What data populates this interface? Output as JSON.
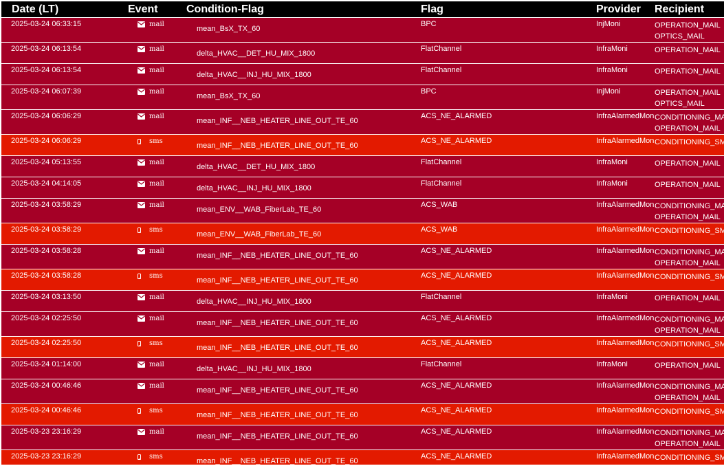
{
  "columns": {
    "date": "Date (LT)",
    "event": "Event",
    "condition": "Condition-Flag",
    "flag": "Flag",
    "provider": "Provider",
    "recipient": "Recipient"
  },
  "colors": {
    "header_bg": "#000000",
    "mail_row_bg": "#a50026",
    "sms_row_bg": "#e31a00",
    "text": "#ffffff"
  },
  "rows": [
    {
      "date": "2025-03-24 06:33:15",
      "event": "mail",
      "icon": "envelope-icon",
      "condition": "mean_BsX_TX_60",
      "flag": "BPC",
      "provider": "InjMoni",
      "recipients": [
        "OPERATION_MAIL",
        "OPTICS_MAIL"
      ]
    },
    {
      "date": "2025-03-24 06:13:54",
      "event": "mail",
      "icon": "envelope-icon",
      "condition": "delta_HVAC__DET_HU_MIX_1800",
      "flag": "FlatChannel",
      "provider": "InfraMoni",
      "recipients": [
        "OPERATION_MAIL"
      ]
    },
    {
      "date": "2025-03-24 06:13:54",
      "event": "mail",
      "icon": "envelope-icon",
      "condition": "delta_HVAC__INJ_HU_MIX_1800",
      "flag": "FlatChannel",
      "provider": "InfraMoni",
      "recipients": [
        "OPERATION_MAIL"
      ]
    },
    {
      "date": "2025-03-24 06:07:39",
      "event": "mail",
      "icon": "envelope-icon",
      "condition": "mean_BsX_TX_60",
      "flag": "BPC",
      "provider": "InjMoni",
      "recipients": [
        "OPERATION_MAIL",
        "OPTICS_MAIL"
      ]
    },
    {
      "date": "2025-03-24 06:06:29",
      "event": "mail",
      "icon": "envelope-icon",
      "condition": "mean_INF__NEB_HEATER_LINE_OUT_TE_60",
      "flag": "ACS_NE_ALARMED",
      "provider": "InfraAlarmedMoni",
      "recipients": [
        "CONDITIONING_MAIL",
        "OPERATION_MAIL"
      ]
    },
    {
      "date": "2025-03-24 06:06:29",
      "event": "sms",
      "icon": "mobile-phone-icon",
      "condition": "mean_INF__NEB_HEATER_LINE_OUT_TE_60",
      "flag": "ACS_NE_ALARMED",
      "provider": "InfraAlarmedMoni",
      "recipients": [
        "CONDITIONING_SMS"
      ]
    },
    {
      "date": "2025-03-24 05:13:55",
      "event": "mail",
      "icon": "envelope-icon",
      "condition": "delta_HVAC__DET_HU_MIX_1800",
      "flag": "FlatChannel",
      "provider": "InfraMoni",
      "recipients": [
        "OPERATION_MAIL"
      ]
    },
    {
      "date": "2025-03-24 04:14:05",
      "event": "mail",
      "icon": "envelope-icon",
      "condition": "delta_HVAC__INJ_HU_MIX_1800",
      "flag": "FlatChannel",
      "provider": "InfraMoni",
      "recipients": [
        "OPERATION_MAIL"
      ]
    },
    {
      "date": "2025-03-24 03:58:29",
      "event": "mail",
      "icon": "envelope-icon",
      "condition": "mean_ENV__WAB_FiberLab_TE_60",
      "flag": "ACS_WAB",
      "provider": "InfraAlarmedMoni",
      "recipients": [
        "CONDITIONING_MAIL",
        "OPERATION_MAIL"
      ]
    },
    {
      "date": "2025-03-24 03:58:29",
      "event": "sms",
      "icon": "mobile-phone-icon",
      "condition": "mean_ENV__WAB_FiberLab_TE_60",
      "flag": "ACS_WAB",
      "provider": "InfraAlarmedMoni",
      "recipients": [
        "CONDITIONING_SMS"
      ]
    },
    {
      "date": "2025-03-24 03:58:28",
      "event": "mail",
      "icon": "envelope-icon",
      "condition": "mean_INF__NEB_HEATER_LINE_OUT_TE_60",
      "flag": "ACS_NE_ALARMED",
      "provider": "InfraAlarmedMoni",
      "recipients": [
        "CONDITIONING_MAIL",
        "OPERATION_MAIL"
      ]
    },
    {
      "date": "2025-03-24 03:58:28",
      "event": "sms",
      "icon": "mobile-phone-icon",
      "condition": "mean_INF__NEB_HEATER_LINE_OUT_TE_60",
      "flag": "ACS_NE_ALARMED",
      "provider": "InfraAlarmedMoni",
      "recipients": [
        "CONDITIONING_SMS"
      ]
    },
    {
      "date": "2025-03-24 03:13:50",
      "event": "mail",
      "icon": "envelope-icon",
      "condition": "delta_HVAC__INJ_HU_MIX_1800",
      "flag": "FlatChannel",
      "provider": "InfraMoni",
      "recipients": [
        "OPERATION_MAIL"
      ]
    },
    {
      "date": "2025-03-24 02:25:50",
      "event": "mail",
      "icon": "envelope-icon",
      "condition": "mean_INF__NEB_HEATER_LINE_OUT_TE_60",
      "flag": "ACS_NE_ALARMED",
      "provider": "InfraAlarmedMoni",
      "recipients": [
        "CONDITIONING_MAIL",
        "OPERATION_MAIL"
      ]
    },
    {
      "date": "2025-03-24 02:25:50",
      "event": "sms",
      "icon": "mobile-phone-icon",
      "condition": "mean_INF__NEB_HEATER_LINE_OUT_TE_60",
      "flag": "ACS_NE_ALARMED",
      "provider": "InfraAlarmedMoni",
      "recipients": [
        "CONDITIONING_SMS"
      ]
    },
    {
      "date": "2025-03-24 01:14:00",
      "event": "mail",
      "icon": "envelope-icon",
      "condition": "delta_HVAC__INJ_HU_MIX_1800",
      "flag": "FlatChannel",
      "provider": "InfraMoni",
      "recipients": [
        "OPERATION_MAIL"
      ]
    },
    {
      "date": "2025-03-24 00:46:46",
      "event": "mail",
      "icon": "envelope-icon",
      "condition": "mean_INF__NEB_HEATER_LINE_OUT_TE_60",
      "flag": "ACS_NE_ALARMED",
      "provider": "InfraAlarmedMoni",
      "recipients": [
        "CONDITIONING_MAIL",
        "OPERATION_MAIL"
      ]
    },
    {
      "date": "2025-03-24 00:46:46",
      "event": "sms",
      "icon": "mobile-phone-icon",
      "condition": "mean_INF__NEB_HEATER_LINE_OUT_TE_60",
      "flag": "ACS_NE_ALARMED",
      "provider": "InfraAlarmedMoni",
      "recipients": [
        "CONDITIONING_SMS"
      ]
    },
    {
      "date": "2025-03-23 23:16:29",
      "event": "mail",
      "icon": "envelope-icon",
      "condition": "mean_INF__NEB_HEATER_LINE_OUT_TE_60",
      "flag": "ACS_NE_ALARMED",
      "provider": "InfraAlarmedMoni",
      "recipients": [
        "CONDITIONING_MAIL",
        "OPERATION_MAIL"
      ]
    },
    {
      "date": "2025-03-23 23:16:29",
      "event": "sms",
      "icon": "mobile-phone-icon",
      "condition": "mean_INF__NEB_HEATER_LINE_OUT_TE_60",
      "flag": "ACS_NE_ALARMED",
      "provider": "InfraAlarmedMoni",
      "recipients": [
        "CONDITIONING_SMS"
      ]
    }
  ]
}
